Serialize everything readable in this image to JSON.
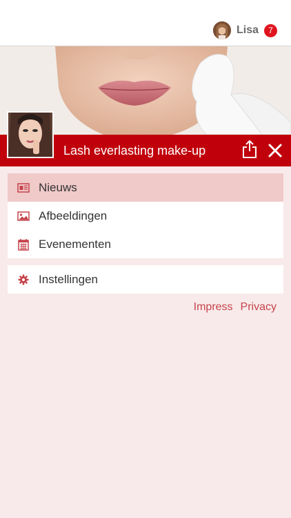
{
  "header": {
    "user_name": "Lisa",
    "notification_count": "7",
    "app_title": "Lash everlasting make-up"
  },
  "menu": {
    "group1": [
      {
        "label": "Nieuws",
        "icon": "newspaper-icon",
        "active": true
      },
      {
        "label": "Afbeeldingen",
        "icon": "image-icon",
        "active": false
      },
      {
        "label": "Evenementen",
        "icon": "calendar-icon",
        "active": false
      }
    ],
    "group2": [
      {
        "label": "Instellingen",
        "icon": "gear-icon",
        "active": false
      }
    ]
  },
  "footer_links": {
    "impress": "Impress",
    "privacy": "Privacy"
  },
  "colors": {
    "brand_red": "#c0000b",
    "badge_red": "#e0141e",
    "background": "#f8eaea",
    "active_item": "#f0c9c9",
    "link": "#c6434b"
  }
}
